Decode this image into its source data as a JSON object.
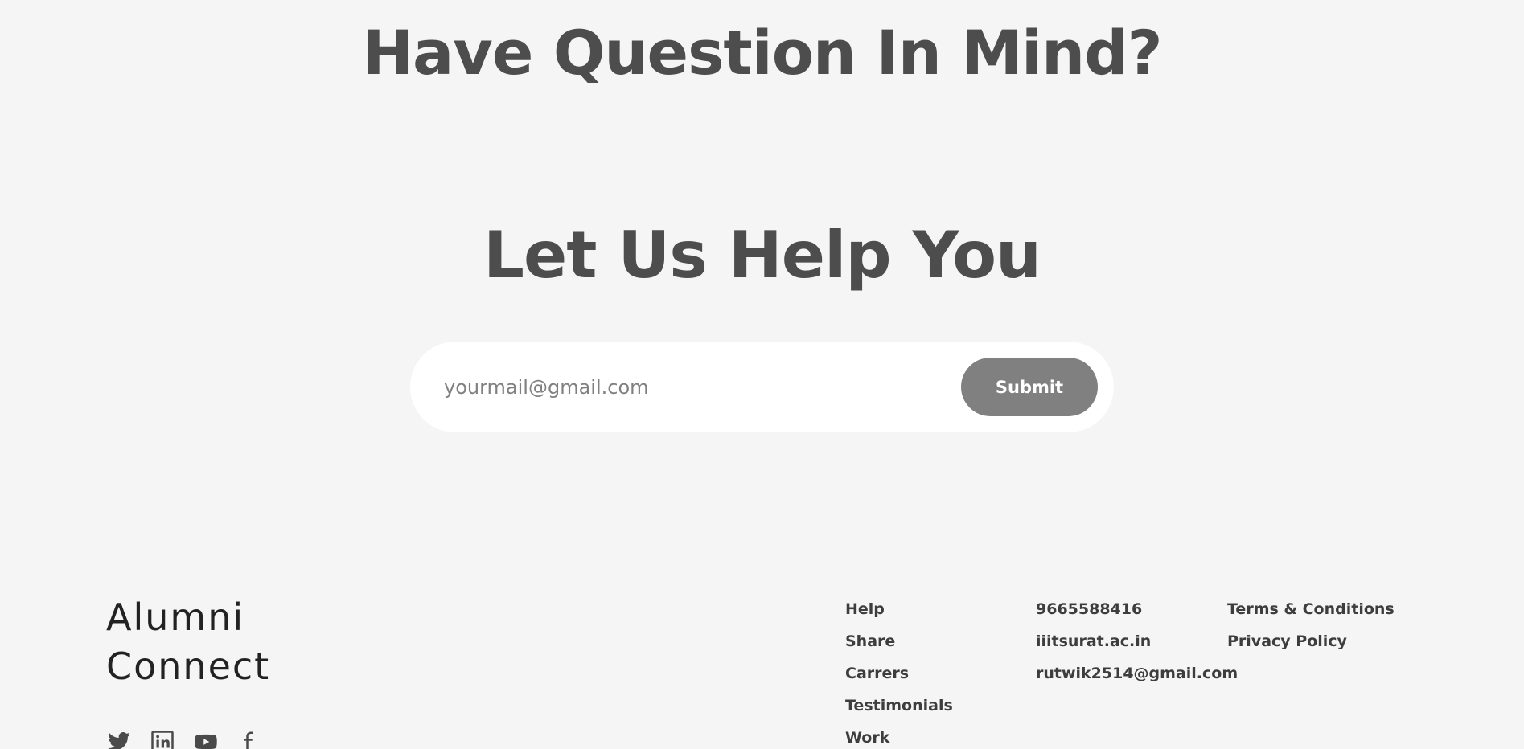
{
  "hero": {
    "headline_top": "Have Question In Mind?",
    "headline_main": "Let Us Help You"
  },
  "subscribe": {
    "placeholder": "yourmail@gmail.com",
    "submit_label": "Submit"
  },
  "footer": {
    "brand_line1": "Alumni",
    "brand_line2": "Connect",
    "social_icons": [
      "twitter-icon",
      "linkedin-icon",
      "youtube-icon",
      "facebook-icon"
    ],
    "links": [
      "Help",
      "Share",
      "Carrers",
      "Testimonials",
      "Work"
    ],
    "contact": [
      "9665588416",
      "iiitsurat.ac.in",
      "rutwik2514@gmail.com"
    ],
    "legal": [
      "Terms & Conditions",
      "Privacy Policy"
    ]
  },
  "colors": {
    "background": "#f5f5f5",
    "heading": "#4d4d4d",
    "button": "#808080",
    "field": "#ffffff"
  }
}
